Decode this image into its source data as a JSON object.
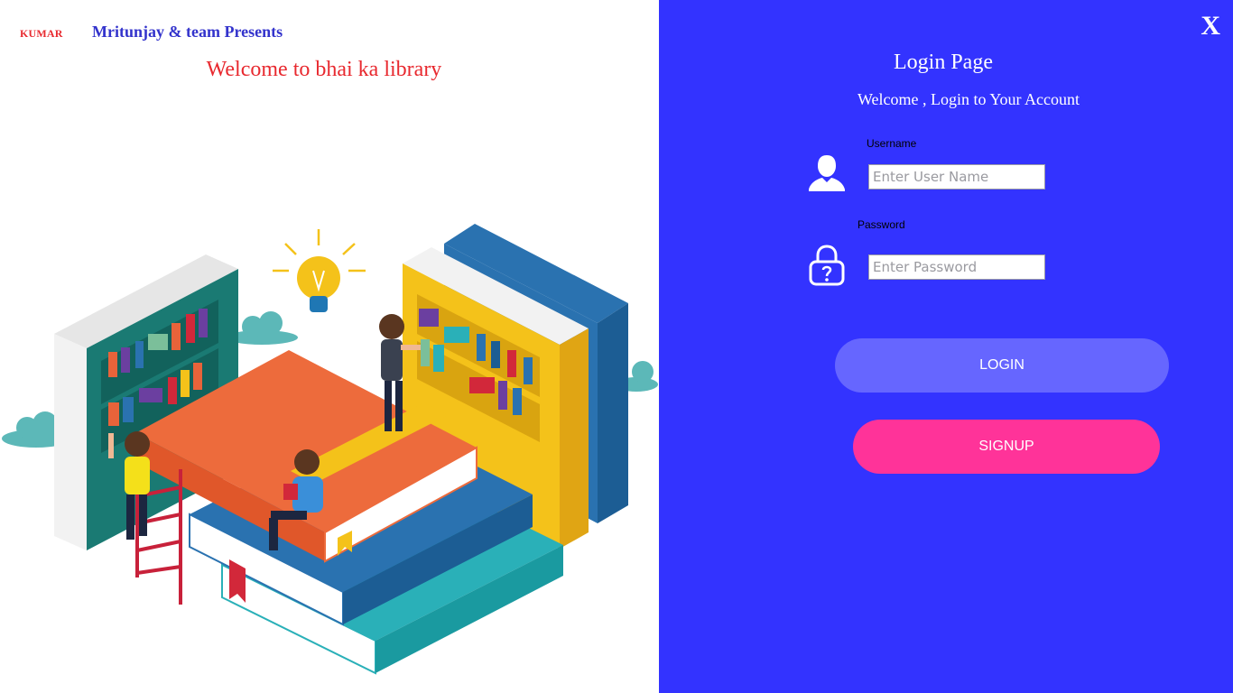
{
  "header": {
    "logo_text": "KUMAR",
    "presents": "Mritunjay & team Presents",
    "welcome": "Welcome to bhai ka library"
  },
  "illustration": {
    "name": "library-books-illustration"
  },
  "login": {
    "close_label": "X",
    "title": "Login Page",
    "subtitle": "Welcome , Login to Your Account",
    "username_label": "Username",
    "username_placeholder": "Enter User Name",
    "username_value": "",
    "password_label": "Password",
    "password_placeholder": "Enter Password",
    "password_value": "",
    "login_button": "LOGIN",
    "signup_button": "SIGNUP"
  },
  "icons": {
    "user": "user-icon",
    "lock": "lock-question-icon"
  },
  "colors": {
    "panel_bg": "#3333ff",
    "login_btn": "#6666ff",
    "signup_btn": "#ff3399",
    "welcome_text": "#e8292f",
    "presents_text": "#3333cc"
  }
}
